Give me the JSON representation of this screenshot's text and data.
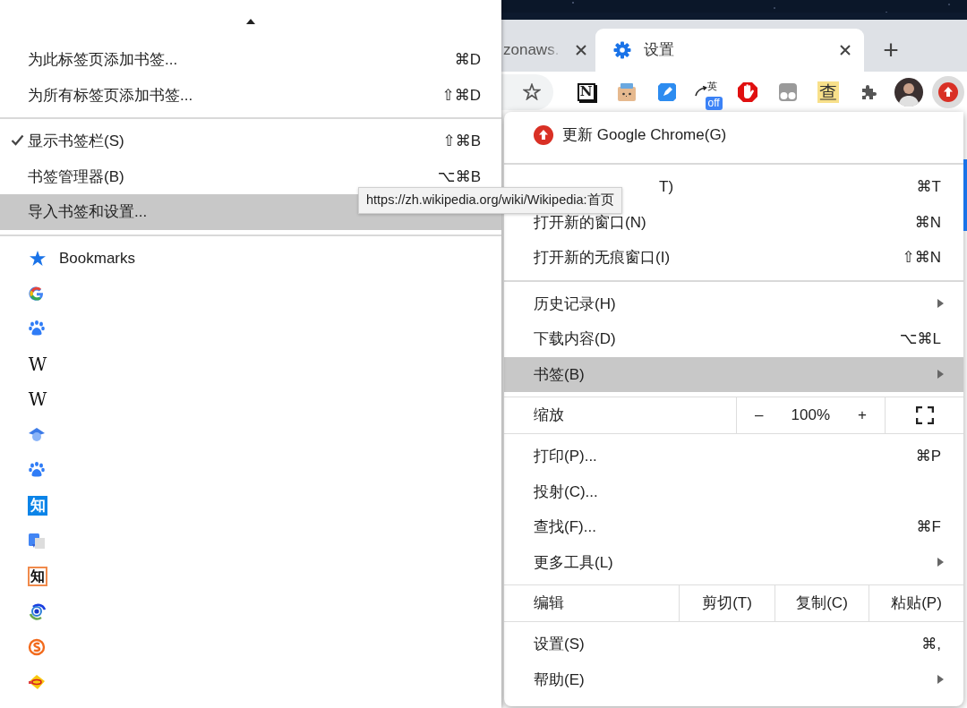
{
  "bookmarks_menu": {
    "items": [
      {
        "kind": "item",
        "label": "为此标签页添加书签...",
        "shortcut": "⌘D",
        "checked": false,
        "selected": false
      },
      {
        "kind": "item",
        "label": "为所有标签页添加书签...",
        "shortcut": "⇧⌘D",
        "checked": false,
        "selected": false
      },
      {
        "kind": "separator"
      },
      {
        "kind": "item",
        "label": "显示书签栏(S)",
        "shortcut": "⇧⌘B",
        "checked": true,
        "selected": false
      },
      {
        "kind": "item",
        "label": "书签管理器(B)",
        "shortcut": "⌥⌘B",
        "checked": false,
        "selected": false
      },
      {
        "kind": "item",
        "label": "导入书签和设置...",
        "checked": false,
        "selected": true
      },
      {
        "kind": "separator"
      },
      {
        "kind": "folder",
        "label": "Bookmarks",
        "selected": false
      },
      {
        "kind": "bookmark",
        "selected": false
      },
      {
        "kind": "bookmark",
        "selected": false
      },
      {
        "kind": "bookmark",
        "glyph": "W",
        "selected": false
      },
      {
        "kind": "bookmark",
        "glyph": "W",
        "selected": false
      },
      {
        "kind": "bookmark",
        "selected": false
      },
      {
        "kind": "bookmark",
        "selected": false
      },
      {
        "kind": "bookmark",
        "glyph": "知",
        "selected": false
      },
      {
        "kind": "bookmark",
        "selected": false
      },
      {
        "kind": "bookmark",
        "glyph": "知",
        "selected": false
      },
      {
        "kind": "bookmark",
        "selected": false
      },
      {
        "kind": "bookmark",
        "selected": false
      },
      {
        "kind": "bookmark",
        "selected": false
      }
    ]
  },
  "tooltip": {
    "text": "https://zh.wikipedia.org/wiki/Wikipedia:首页"
  },
  "tabs": [
    {
      "label": "zonaws.",
      "selected": false
    },
    {
      "label": "设置",
      "selected": true
    }
  ],
  "new_tab": "+",
  "toolbar": {
    "notion_glyph": "N",
    "translate_glyph": "英",
    "translate_badge": "off",
    "lookup_glyph": "查"
  },
  "chrome_menu": {
    "items": [
      {
        "kind": "update",
        "label": "更新 Google Chrome(G)"
      },
      {
        "kind": "separator"
      },
      {
        "kind": "item",
        "label": "T)",
        "shortcut": "⌘T",
        "partly_hidden": true,
        "submenu": false,
        "selected": false
      },
      {
        "kind": "item",
        "label": "打开新的窗口(N)",
        "shortcut": "⌘N",
        "submenu": false,
        "selected": false
      },
      {
        "kind": "item",
        "label": "打开新的无痕窗口(I)",
        "shortcut": "⇧⌘N",
        "submenu": false,
        "selected": false
      },
      {
        "kind": "separator"
      },
      {
        "kind": "item",
        "label": "历史记录(H)",
        "submenu": true,
        "selected": false
      },
      {
        "kind": "item",
        "label": "下载内容(D)",
        "shortcut": "⌥⌘L",
        "submenu": false,
        "selected": false
      },
      {
        "kind": "item",
        "label": "书签(B)",
        "submenu": true,
        "selected": true
      },
      {
        "kind": "zoom",
        "label": "缩放",
        "minus": "–",
        "value": "100%",
        "plus": "+"
      },
      {
        "kind": "item",
        "label": "打印(P)...",
        "shortcut": "⌘P",
        "submenu": false,
        "selected": false
      },
      {
        "kind": "item",
        "label": "投射(C)...",
        "submenu": false,
        "selected": false
      },
      {
        "kind": "item",
        "label": "查找(F)...",
        "shortcut": "⌘F",
        "submenu": false,
        "selected": false
      },
      {
        "kind": "item",
        "label": "更多工具(L)",
        "submenu": true,
        "selected": false
      },
      {
        "kind": "edit",
        "label": "编辑",
        "buttons": [
          "剪切(T)",
          "复制(C)",
          "粘贴(P)"
        ]
      },
      {
        "kind": "item",
        "label": "设置(S)",
        "shortcut": "⌘,",
        "submenu": false,
        "selected": false
      },
      {
        "kind": "item",
        "label": "帮助(E)",
        "submenu": true,
        "selected": false
      }
    ]
  }
}
